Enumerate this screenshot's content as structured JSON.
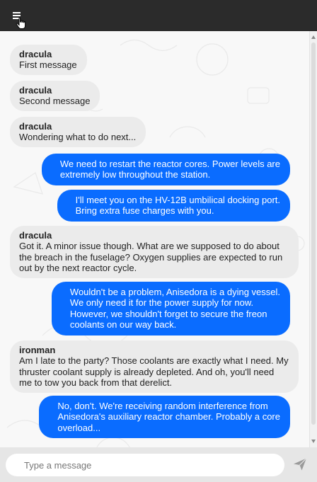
{
  "header": {
    "menu_icon": "hamburger-menu-icon",
    "cursor_icon": "hand-pointer-icon",
    "background": "#2b2b2b"
  },
  "messages": [
    {
      "direction": "in",
      "sender": "dracula",
      "lines": [
        "First message"
      ]
    },
    {
      "direction": "in",
      "sender": "dracula",
      "lines": [
        "Second message"
      ]
    },
    {
      "direction": "in",
      "sender": "dracula",
      "lines": [
        "Wondering what to do next..."
      ]
    },
    {
      "direction": "out",
      "lines": [
        "We need to restart the reactor cores. Power levels are",
        "extremely low throughout the station."
      ]
    },
    {
      "direction": "out",
      "lines": [
        "I'll meet you on the HV-12B umbilical docking port.",
        "Bring extra fuse charges with you."
      ]
    },
    {
      "direction": "in",
      "sender": "dracula",
      "lines": [
        "Got it. A minor issue though. What are we supposed to do about",
        "the breach in the fuselage? Oxygen supplies are expected to run",
        "out by the next reactor cycle."
      ]
    },
    {
      "direction": "out",
      "lines": [
        "Wouldn't be a problem, Anisedora is a dying vessel.",
        "We only need it for the power supply for now.",
        "However, we shouldn't forget to secure the freon",
        "coolants on our way back."
      ]
    },
    {
      "direction": "in",
      "sender": "ironman",
      "lines": [
        "Am I late to the party? Those coolants are exactly what I need. My",
        "thruster coolant supply is already depleted. And oh, you'll need",
        "me to tow you back from that derelict."
      ]
    },
    {
      "direction": "out",
      "lines": [
        "No, don't. We're receiving random interference from",
        "Anisedora's auxiliary reactor chamber. Probably a core",
        "overload..."
      ]
    }
  ],
  "composer": {
    "placeholder": "Type a message",
    "value": "",
    "send_icon": "paper-plane-send-icon"
  },
  "colors": {
    "outgoing_bubble": "#0a6cff",
    "incoming_bubble": "#ebebeb",
    "chat_background": "#f8f8f8",
    "composer_background": "#e6e6e6"
  }
}
